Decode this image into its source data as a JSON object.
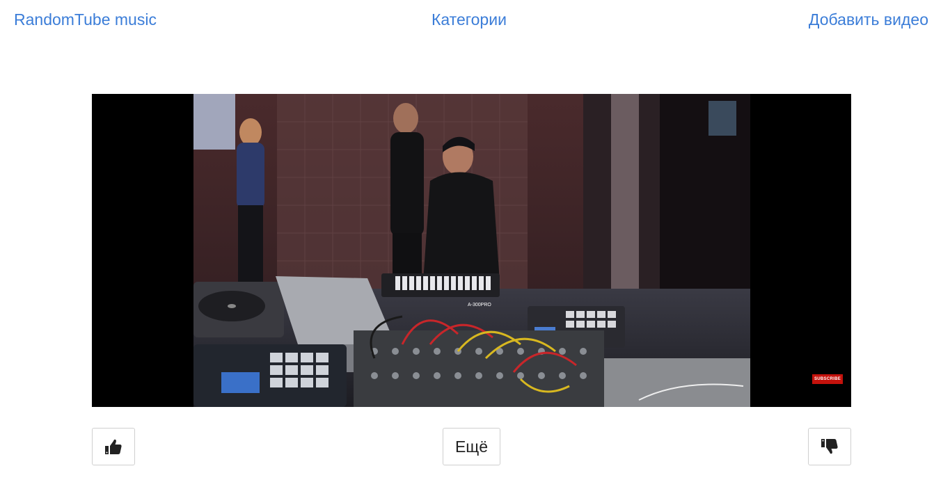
{
  "nav": {
    "brand": "RandomTube music",
    "categories": "Категории",
    "add_video": "Добавить видео"
  },
  "player": {
    "subscribe_label": "SUBSCRIBE",
    "keyboard_label": "A-300PRO"
  },
  "actions": {
    "like_icon": "thumbs-up-icon",
    "more_label": "Ещё",
    "dislike_icon": "thumbs-down-icon"
  },
  "colors": {
    "link": "#3b7dd8",
    "subscribe": "#c4120c"
  }
}
